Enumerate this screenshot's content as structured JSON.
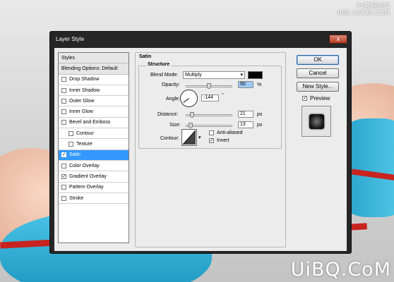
{
  "watermark_top": [
    "PS教程论坛",
    "BBS.16XX8.COM"
  ],
  "watermark_bottom": "UiBQ.CoM",
  "dialog": {
    "title": "Layer Style",
    "close_label": "x"
  },
  "styles_panel": {
    "items": [
      {
        "label": "Styles",
        "type": "head"
      },
      {
        "label": "Blending Options: Default",
        "type": "head"
      },
      {
        "label": "Drop Shadow",
        "checked": false
      },
      {
        "label": "Inner Shadow",
        "checked": false
      },
      {
        "label": "Outer Glow",
        "checked": false
      },
      {
        "label": "Inner Glow",
        "checked": false
      },
      {
        "label": "Bevel and Emboss",
        "checked": false
      },
      {
        "label": "Contour",
        "checked": false,
        "indent": true
      },
      {
        "label": "Texture",
        "checked": false,
        "indent": true
      },
      {
        "label": "Satin",
        "checked": true,
        "selected": true
      },
      {
        "label": "Color Overlay",
        "checked": false
      },
      {
        "label": "Gradient Overlay",
        "checked": true
      },
      {
        "label": "Pattern Overlay",
        "checked": false
      },
      {
        "label": "Stroke",
        "checked": false
      }
    ]
  },
  "satin": {
    "group_title": "Satin",
    "structure_title": "Structure",
    "blend_mode_label": "Blend Mode:",
    "blend_mode_value": "Multiply",
    "blend_color": "#000000",
    "opacity_label": "Opacity:",
    "opacity_value": "50",
    "opacity_unit": "%",
    "opacity_fraction": 0.5,
    "angle_label": "Angle:",
    "angle_value": "-144",
    "angle_unit": "°",
    "distance_label": "Distance:",
    "distance_value": "21",
    "distance_unit": "px",
    "distance_fraction": 0.09,
    "size_label": "Size:",
    "size_value": "13",
    "size_unit": "px",
    "size_fraction": 0.05,
    "contour_label": "Contour:",
    "antialiased_label": "Anti-aliased",
    "antialiased_checked": false,
    "invert_label": "Invert",
    "invert_checked": true
  },
  "buttons": {
    "ok": "OK",
    "cancel": "Cancel",
    "new_style": "New Style...",
    "preview": "Preview",
    "preview_checked": true
  },
  "colors": {
    "selection": "#3399ff",
    "window_frame": "#262626",
    "ribbon": "#d0201e",
    "cyan": "#2ab3d8",
    "skin": "#edb59a"
  }
}
